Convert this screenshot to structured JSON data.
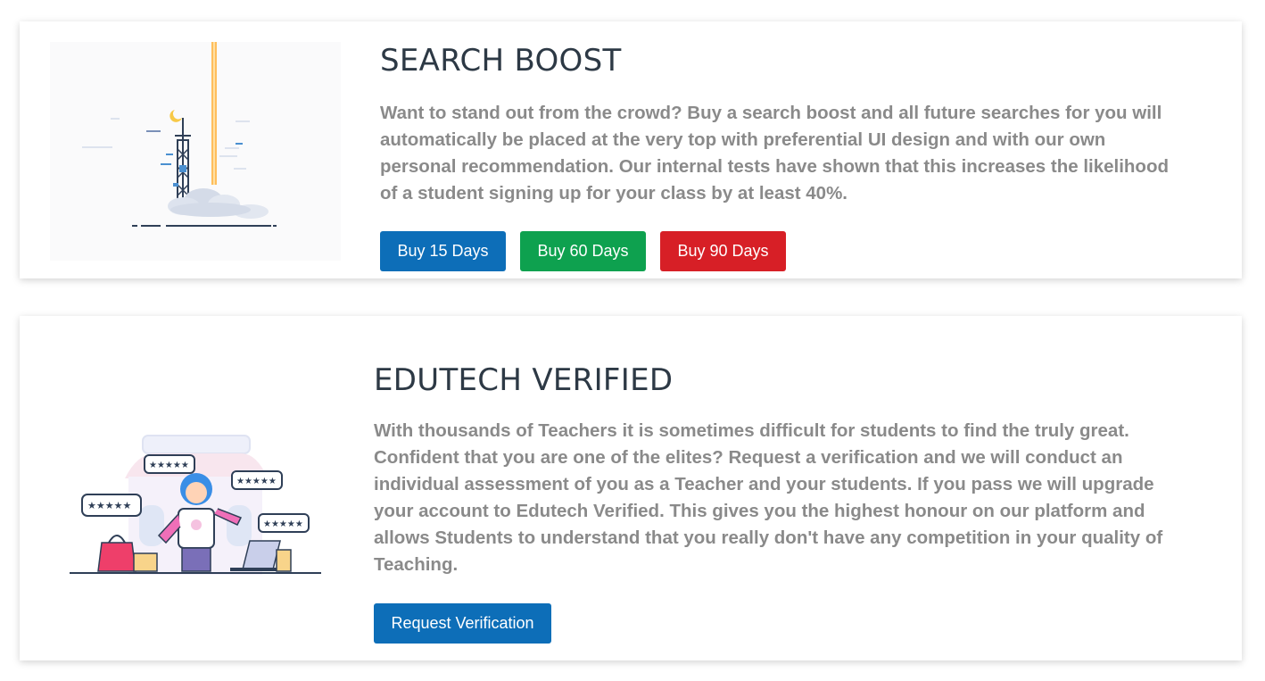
{
  "search_boost": {
    "title": "SEARCH BOOST",
    "description": "Want to stand out from the crowd? Buy a search boost and all future searches for you will automatically be placed at the very top with preferential UI design and with our own personal recommendation. Our internal tests have shown that this increases the likelihood of a student signing up for your class by at least 40%.",
    "buttons": {
      "buy_15": "Buy 15 Days",
      "buy_60": "Buy 60 Days",
      "buy_90": "Buy 90 Days"
    },
    "illustration": "rocket-launch-illustration"
  },
  "edutech_verified": {
    "title": "EDUTECH VERIFIED",
    "description": "With thousands of Teachers it is sometimes difficult for students to find the truly great. Confident that you are one of the elites? Request a verification and we will conduct an individual assessment of you as a Teacher and your students. If you pass we will upgrade your account to Edutech Verified. This gives you the highest honour on our platform and allows Students to understand that you really don't have any competition in your quality of Teaching.",
    "button": "Request Verification",
    "illustration": "teacher-reviews-illustration"
  },
  "colors": {
    "primary": "#0d6eb8",
    "success": "#0ea14f",
    "danger": "#d71f26",
    "title": "#2d3945",
    "text": "#8a8a8a"
  }
}
